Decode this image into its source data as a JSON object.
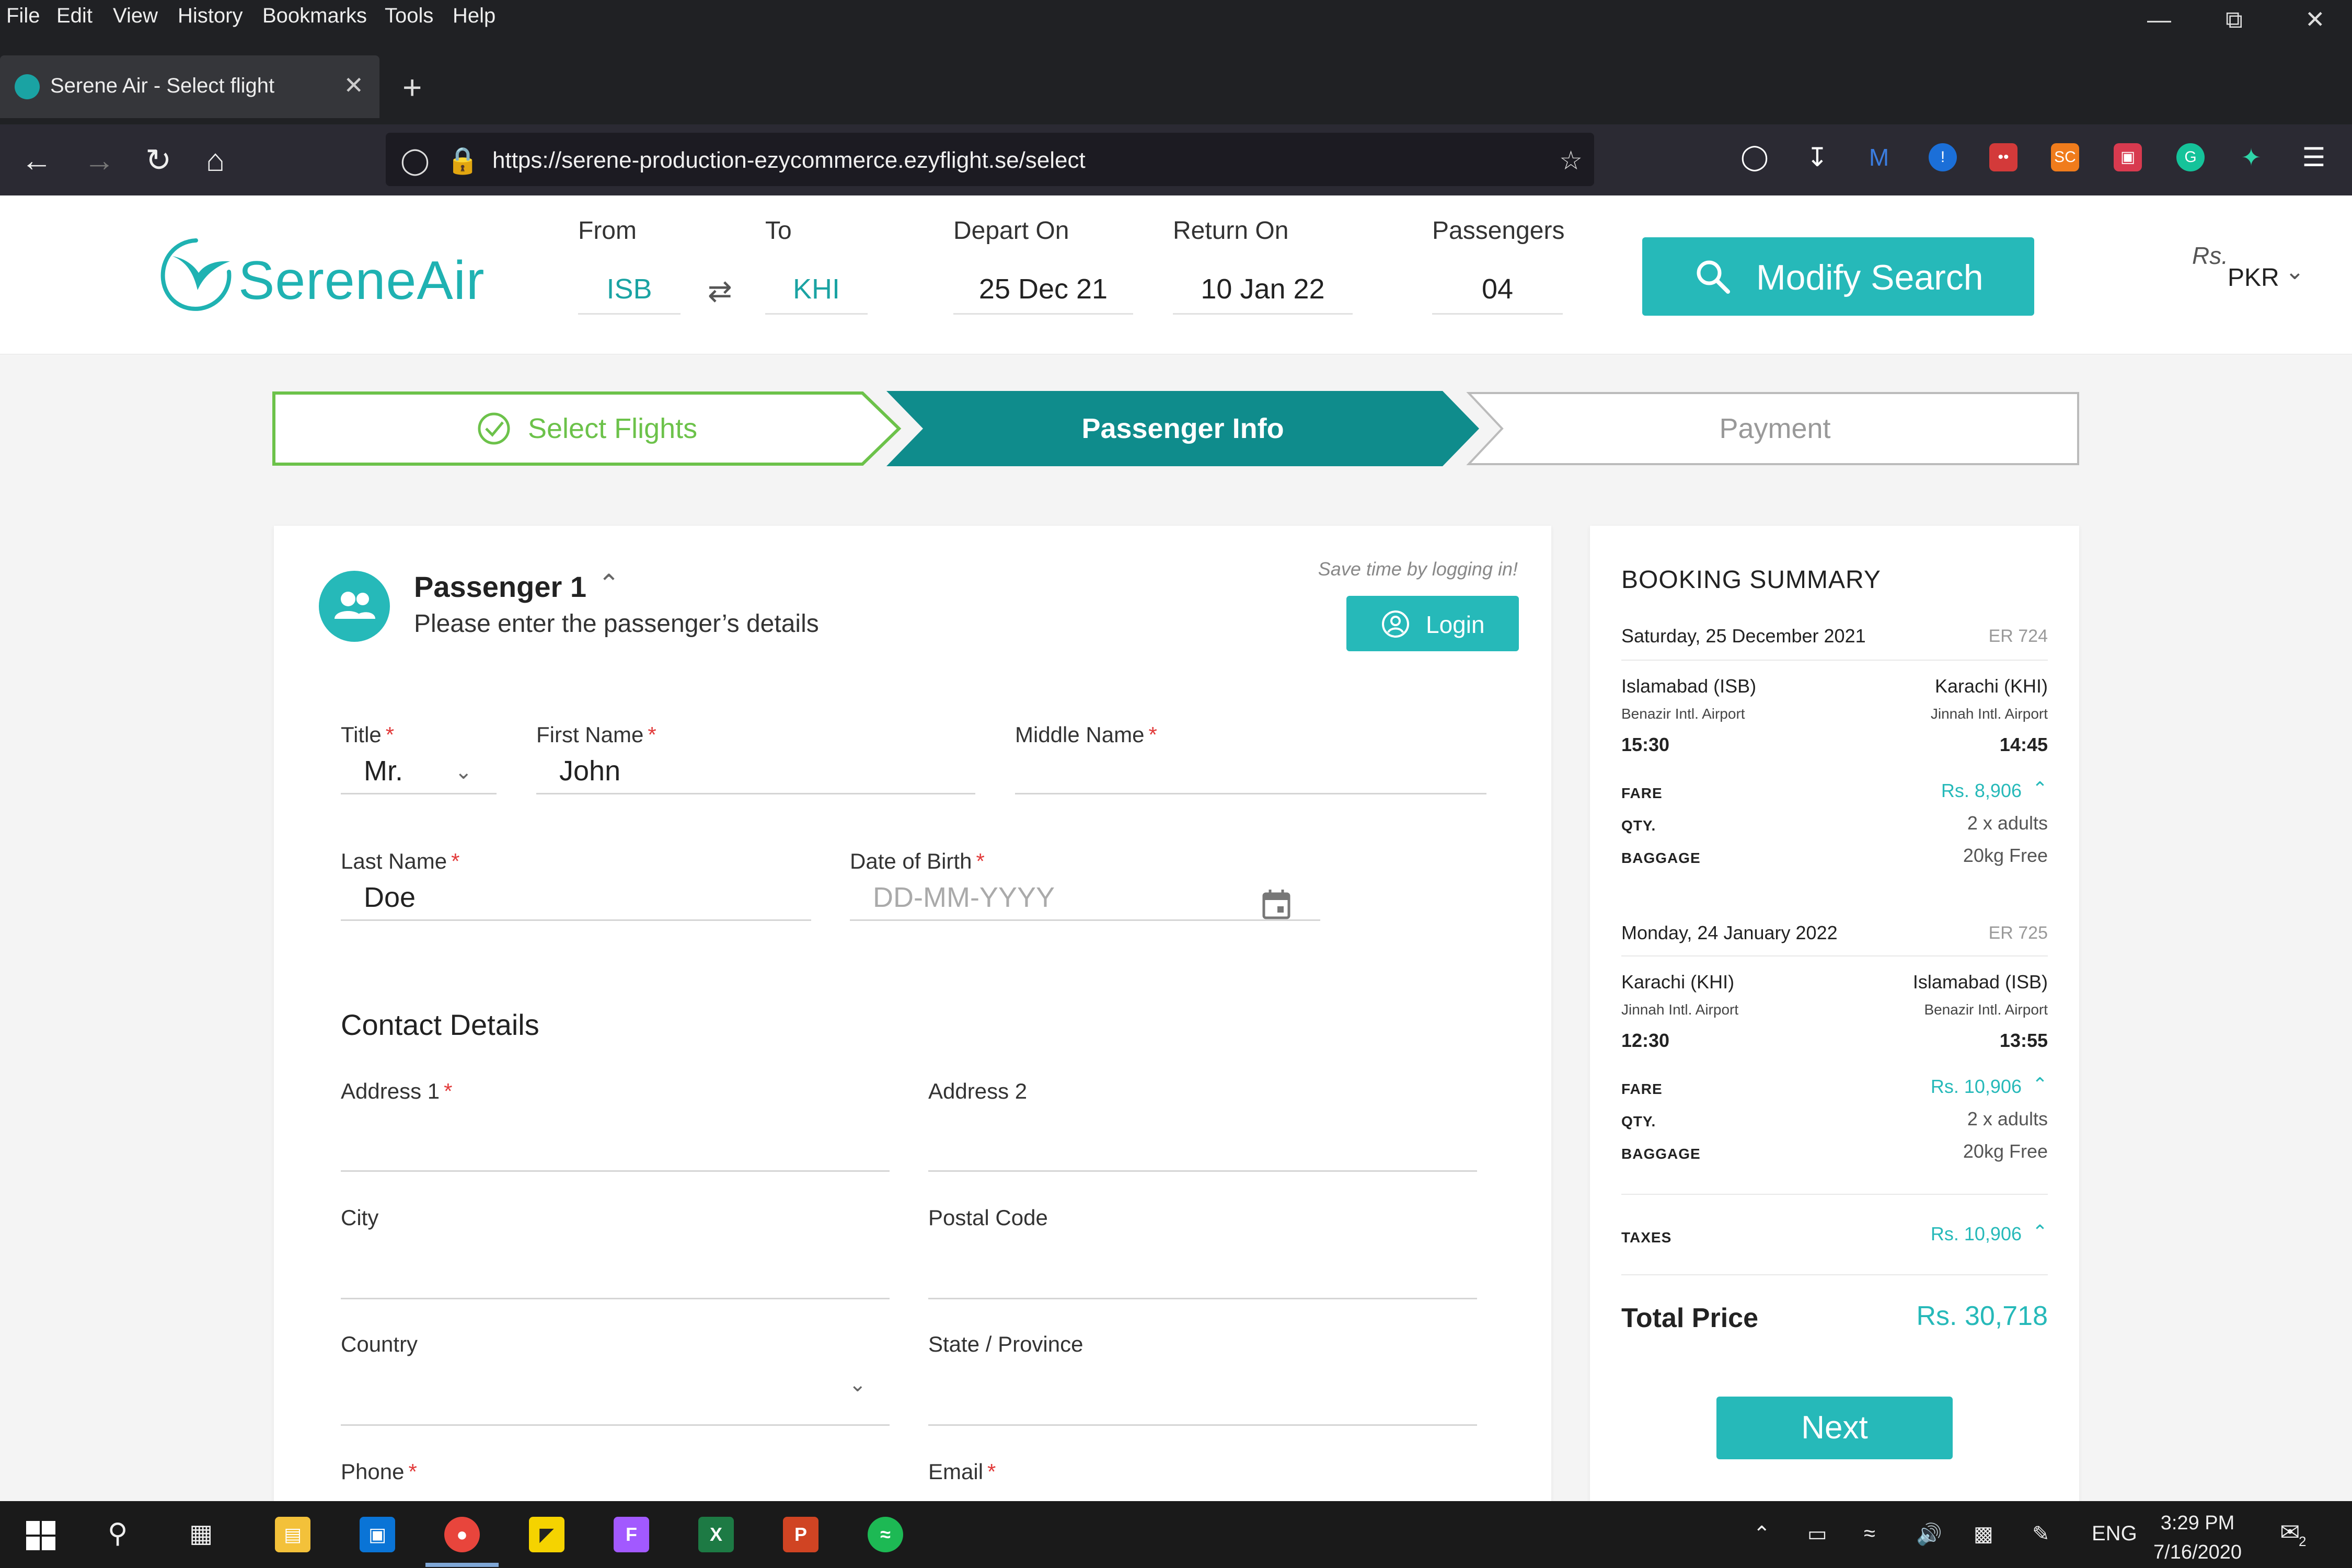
{
  "menubar": {
    "items": [
      "File",
      "Edit",
      "View",
      "History",
      "Bookmarks",
      "Tools",
      "Help"
    ],
    "underline": [
      "F",
      "E",
      "V",
      "s",
      "B",
      "T",
      "H"
    ]
  },
  "browser": {
    "tab_title": "Serene Air - Select flight",
    "url": "https://serene-production-ezycommerce.ezyflight.se/select"
  },
  "header": {
    "logo_text": "SereneAir",
    "from_label": "From",
    "from_value": "ISB",
    "to_label": "To",
    "to_value": "KHI",
    "depart_label": "Depart On",
    "depart_value": "25 Dec 21",
    "return_label": "Return On",
    "return_value": "10 Jan 22",
    "pax_label": "Passengers",
    "pax_value": "04",
    "modify_label": "Modify Search",
    "currency_symbol": "Rs.",
    "currency": "PKR"
  },
  "steps": [
    {
      "label": "Select Flights",
      "state": "done"
    },
    {
      "label": "Passenger Info",
      "state": "active"
    },
    {
      "label": "Payment",
      "state": "todo"
    }
  ],
  "passenger": {
    "title": "Passenger 1",
    "subtitle": "Please enter the passenger’s details",
    "save_hint": "Save time by logging in!",
    "login_label": "Login",
    "fields": {
      "title": {
        "label": "Title",
        "value": "Mr."
      },
      "first_name": {
        "label": "First Name",
        "value": "John"
      },
      "middle_name": {
        "label": "Middle Name",
        "value": ""
      },
      "last_name": {
        "label": "Last Name",
        "value": "Doe"
      },
      "dob": {
        "label": "Date of Birth",
        "placeholder": "DD-MM-YYYY"
      }
    },
    "required_mark": "*",
    "contact_title": "Contact Details",
    "contact": {
      "address1": "Address 1",
      "address2": "Address 2",
      "city": "City",
      "postal": "Postal Code",
      "country": "Country",
      "state": "State / Province",
      "phone": "Phone",
      "email": "Email"
    }
  },
  "summary": {
    "title": "BOOKING SUMMARY",
    "legs": [
      {
        "date": "Saturday, 25 December 2021",
        "flight": "ER 724",
        "from_city": "Islamabad (ISB)",
        "from_airport": "Benazir Intl. Airport",
        "from_time": "15:30",
        "to_city": "Karachi (KHI)",
        "to_airport": "Jinnah Intl. Airport",
        "to_time": "14:45",
        "fare": "Rs. 8,906",
        "qty": "2 x adults",
        "baggage": "20kg Free"
      },
      {
        "date": "Monday, 24 January 2022",
        "flight": "ER 725",
        "from_city": "Karachi (KHI)",
        "from_airport": "Jinnah Intl. Airport",
        "from_time": "12:30",
        "to_city": "Islamabad (ISB)",
        "to_airport": "Benazir Intl. Airport",
        "to_time": "13:55",
        "fare": "Rs. 10,906",
        "qty": "2 x adults",
        "baggage": "20kg Free"
      }
    ],
    "fare_key": "FARE",
    "qty_key": "QTY.",
    "baggage_key": "BAGGAGE",
    "taxes_key": "TAXES",
    "taxes_value": "Rs. 10,906",
    "total_label": "Total Price",
    "total_value": "Rs. 30,718",
    "next_label": "Next"
  },
  "taskbar": {
    "lang": "ENG",
    "time": "3:29 PM",
    "date": "7/16/2020",
    "notif_count": "2"
  },
  "colors": {
    "teal": "#26b9b9",
    "teal_dark": "#0f8c8c",
    "green_step": "#6cc24a",
    "required": "#e23b3b"
  }
}
